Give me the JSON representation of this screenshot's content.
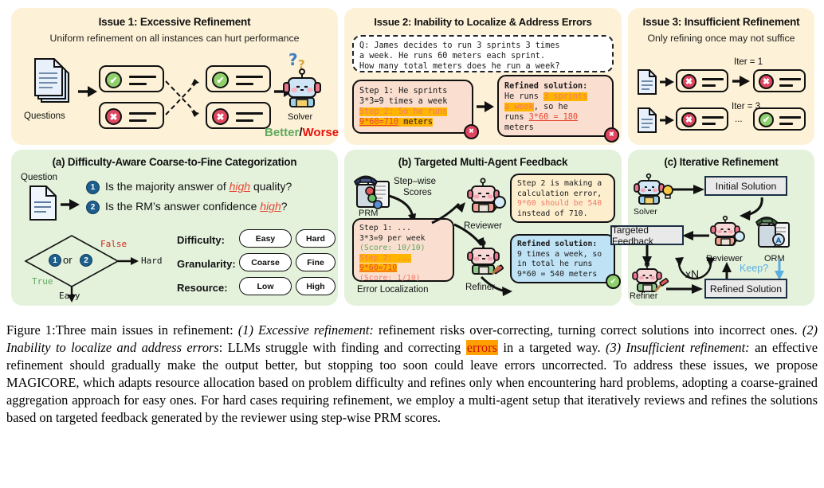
{
  "figure": {
    "caption_label": "Figure 1:",
    "caption_parts": {
      "p0": "Three main issues in refinement: ",
      "i1": "(1) Excessive refinement:",
      "p1": " refinement risks over-correcting, turning correct solutions into incorrect ones. ",
      "i2": "(2) Inability to localize and address errors",
      "p2": ": LLMs struggle with finding and correcting ",
      "hl": "errors",
      "p3": " in a targeted way. ",
      "i3": "(3) Insufficient refinement:",
      "p4": " an effective refinement should gradually make the output better, but stopping too soon could leave errors uncorrected. To address these issues, we propose ",
      "magicore": "MAGICORE",
      "p5": ", which adapts resource allocation based on problem difficulty and refines only when encountering hard problems, adopting a coarse-grained aggregation approach for easy ones. For hard cases requiring refinement, we employ a multi-agent setup that iteratively reviews and refines the solutions based on targeted feedback generated by the reviewer using step-wise PRM scores."
    }
  },
  "colors": {
    "cream_panel": "#fdf2d7",
    "green_panel": "#e4f2dc",
    "ok_green": "#8ed06a",
    "bad_red": "#e0465f",
    "highlight_orange": "#ffb400",
    "peach_box": "#fadfd0",
    "blue_box": "#bfe2f5",
    "accent_blue": "#1d5e8c"
  },
  "issue1": {
    "title": "Issue 1: Excessive Refinement",
    "subtitle": "Uniform refinement on all instances can hurt performance",
    "questions_label": "Questions",
    "solver_label": "Solver",
    "outcome_better": "Better",
    "outcome_slash": "/",
    "outcome_worse": "Worse",
    "left_states": [
      "correct",
      "incorrect"
    ],
    "right_states": [
      "correct",
      "incorrect"
    ]
  },
  "issue2": {
    "title": "Issue 2: Inability to Localize & Address Errors",
    "question": {
      "line1": "Q: James decides to run 3 sprints 3 times",
      "line2": "a week. He runs 60 meters each sprint.",
      "line3": "How many total meters does he run a week?"
    },
    "initial_solution": {
      "line1": "Step 1: He sprints",
      "line2": "3*3=9 times a week",
      "line3_hl": "Step 2: So he runs",
      "line4_hl": "9*60=710",
      "line4_tail": " meters",
      "status": "incorrect"
    },
    "refined_solution": {
      "header": "Refined solution:",
      "l1_pre": "He runs ",
      "l1_hl": "3 sprints",
      "l2_hl": "a week",
      "l2_tail": ", so he",
      "l3_pre": "runs ",
      "l3_u": "3*60 = 180",
      "l4": "meters",
      "status": "incorrect"
    }
  },
  "issue3": {
    "title": "Issue 3: Insufficient Refinement",
    "subtitle": "Only refining once may not suffice",
    "row1": {
      "iter_label": "Iter = 1",
      "start": "incorrect",
      "end": "incorrect"
    },
    "row2": {
      "iter_label": "Iter = 3",
      "ellipsis": "...",
      "start": "incorrect",
      "end": "correct"
    }
  },
  "panel_a": {
    "title": "(a) Difficulty-Aware Coarse-to-Fine Categorization",
    "question_label": "Question",
    "q1_num": "1",
    "q1_pre": "Is the majority answer of ",
    "q1_em": "high",
    "q1_post": " quality?",
    "q2_num": "2",
    "q2_pre": "Is the RM’s answer confidence ",
    "q2_em": "high",
    "q2_post": "?",
    "diamond_pre": "1",
    "diamond_or": " or ",
    "diamond_post": "2",
    "false_label": "False",
    "true_label": "True",
    "hard_label": "Hard",
    "easy_label": "Easy",
    "rows": [
      {
        "label": "Difficulty:",
        "left": "Easy",
        "right": "Hard"
      },
      {
        "label": "Granularity:",
        "left": "Coarse",
        "right": "Fine"
      },
      {
        "label": "Resource:",
        "left": "Low",
        "right": "High"
      }
    ]
  },
  "panel_b": {
    "title": "(b) Targeted Multi-Agent Feedback",
    "prm_label": "PRM",
    "stepwise_l1": "Step–wise",
    "stepwise_l2": "Scores",
    "reviewer_label": "Reviewer",
    "refiner_label": "Refiner",
    "error_localization_label": "Error Localization",
    "localization_box": {
      "l1": "Step 1: ...",
      "l2": "3*3=9 per week",
      "l3": "(Score: 10/10)",
      "l4_hl": "Step 2: ...",
      "l5_hl": "9*60=710",
      "l6": "(Score: 1/10)"
    },
    "reviewer_box": {
      "l1": "Step 2 is making a",
      "l2": "calculation error,",
      "l3_red": "9*60 should be 540",
      "l4": "instead of 710."
    },
    "refiner_box": {
      "header": "Refined solution:",
      "l1": "9 times a week, so",
      "l2": "in total he runs",
      "l3": "9*60 = 540 meters",
      "status": "correct"
    }
  },
  "panel_c": {
    "title": "(c) Iterative Refinement",
    "solver_label": "Solver",
    "reviewer_label": "Reviewer",
    "refiner_label": "Refiner",
    "orm_label": "ORM",
    "initial_solution": "Initial Solution",
    "targeted_feedback": "Targeted Feedback",
    "refined_solution": "Refined Solution",
    "loop_label": "xN",
    "keep_label": "Keep?"
  }
}
